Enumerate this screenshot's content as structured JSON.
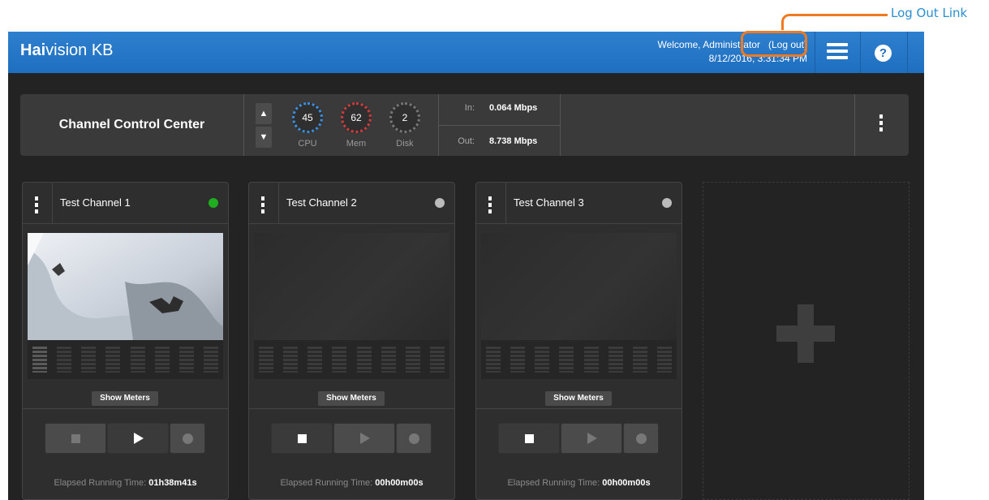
{
  "annotation": {
    "label": "Log Out Link"
  },
  "header": {
    "brand_bold": "Hai",
    "brand_rest": "vision KB",
    "welcome": "Welcome, Administrator",
    "logout": "(Log out)",
    "datetime": "8/12/2016, 3:31:34 PM",
    "accent_color": "#1f6fc0"
  },
  "control_center": {
    "title": "Channel Control Center",
    "gauges": [
      {
        "value": "45",
        "label": "CPU",
        "color": "#3a8fe0"
      },
      {
        "value": "62",
        "label": "Mem",
        "color": "#d23b3b"
      },
      {
        "value": "2",
        "label": "Disk",
        "color": "#777777"
      }
    ],
    "throughput": {
      "in_label": "In:",
      "in_value": "0.064 Mbps",
      "out_label": "Out:",
      "out_value": "8.738 Mbps"
    }
  },
  "channels": [
    {
      "title": "Test Channel 1",
      "status_color": "#1fae1f",
      "show_meters": "Show Meters",
      "elapsed_label": "Elapsed Running Time:",
      "elapsed_value": "01h38m41s"
    },
    {
      "title": "Test Channel 2",
      "status_color": "#bbbbbb",
      "show_meters": "Show Meters",
      "elapsed_label": "Elapsed Running Time:",
      "elapsed_value": "00h00m00s"
    },
    {
      "title": "Test Channel 3",
      "status_color": "#bbbbbb",
      "show_meters": "Show Meters",
      "elapsed_label": "Elapsed Running Time:",
      "elapsed_value": "00h00m00s"
    }
  ],
  "icons": [
    "hamburger-icon",
    "help-icon",
    "kebab-icon",
    "stop-icon",
    "play-icon",
    "record-icon",
    "plus-icon",
    "arrow-up-icon",
    "arrow-down-icon"
  ]
}
